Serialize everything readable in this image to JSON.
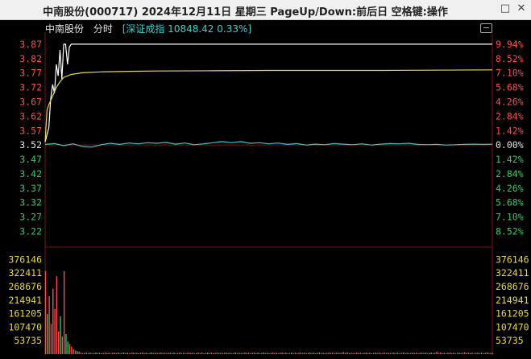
{
  "window": {
    "title": "中南股份(000717) 2024年12月11日 星期三 PageUp/Down:前后日 空格键:操作",
    "minimize_icon": "minimize-icon",
    "close_icon": "close-icon"
  },
  "header": {
    "stock_name": "中南股份",
    "chart_mode": "分时",
    "index_info": "[深证成指 10848.42 0.33%]",
    "toggle_icon": "collapse-icon"
  },
  "colors": {
    "background": "#000000",
    "up": "#ff4d4d",
    "down": "#33cc66",
    "neutral": "#e6e6e6",
    "price_line": "#ffffff",
    "avg_line": "#e8d94a",
    "index_line": "#3fc4c8",
    "volume_label": "#e8d94a",
    "grid": "#7a0f0f"
  },
  "chart_data": [
    {
      "type": "line",
      "title": "",
      "left_axis_ticks": [
        "3.87",
        "3.82",
        "3.77",
        "3.72",
        "3.67",
        "3.62",
        "3.57",
        "3.52",
        "3.47",
        "3.42",
        "3.37",
        "3.32",
        "3.27",
        "3.22"
      ],
      "right_axis_ticks": [
        "9.94%",
        "8.52%",
        "7.10%",
        "5.68%",
        "4.26%",
        "2.84%",
        "1.42%",
        "0.00%",
        "1.42%",
        "2.84%",
        "4.26%",
        "5.68%",
        "7.10%",
        "8.52%"
      ],
      "prev_close": 3.52,
      "ylim": [
        3.185,
        3.895
      ],
      "x_minutes": 240,
      "series": [
        {
          "key": "price",
          "points": [
            [
              0,
              3.53
            ],
            [
              2,
              3.58
            ],
            [
              3,
              3.68
            ],
            [
              4,
              3.73
            ],
            [
              5,
              3.7
            ],
            [
              6,
              3.8
            ],
            [
              7,
              3.76
            ],
            [
              8,
              3.85
            ],
            [
              9,
              3.75
            ],
            [
              10,
              3.87
            ],
            [
              11,
              3.87
            ],
            [
              12,
              3.8
            ],
            [
              13,
              3.86
            ],
            [
              14,
              3.87
            ],
            [
              15,
              3.87
            ],
            [
              240,
              3.87
            ]
          ]
        },
        {
          "key": "avg",
          "points": [
            [
              0,
              3.53
            ],
            [
              1,
              3.64
            ],
            [
              2,
              3.66
            ],
            [
              4,
              3.69
            ],
            [
              6,
              3.72
            ],
            [
              8,
              3.74
            ],
            [
              10,
              3.755
            ],
            [
              14,
              3.765
            ],
            [
              20,
              3.771
            ],
            [
              30,
              3.774
            ],
            [
              45,
              3.776
            ],
            [
              60,
              3.777
            ],
            [
              90,
              3.778
            ],
            [
              120,
              3.779
            ],
            [
              180,
              3.779
            ],
            [
              240,
              3.781
            ]
          ]
        },
        {
          "key": "index",
          "points": [
            [
              0,
              3.522
            ],
            [
              5,
              3.525
            ],
            [
              10,
              3.518
            ],
            [
              15,
              3.524
            ],
            [
              20,
              3.515
            ],
            [
              25,
              3.513
            ],
            [
              30,
              3.521
            ],
            [
              35,
              3.526
            ],
            [
              40,
              3.522
            ],
            [
              45,
              3.527
            ],
            [
              50,
              3.524
            ],
            [
              55,
              3.528
            ],
            [
              60,
              3.526
            ],
            [
              65,
              3.529
            ],
            [
              70,
              3.523
            ],
            [
              75,
              3.527
            ],
            [
              80,
              3.521
            ],
            [
              85,
              3.524
            ],
            [
              90,
              3.528
            ],
            [
              95,
              3.532
            ],
            [
              100,
              3.528
            ],
            [
              105,
              3.532
            ],
            [
              110,
              3.526
            ],
            [
              115,
              3.528
            ],
            [
              120,
              3.524
            ],
            [
              125,
              3.527
            ],
            [
              130,
              3.522
            ],
            [
              135,
              3.525
            ],
            [
              140,
              3.52
            ],
            [
              145,
              3.523
            ],
            [
              150,
              3.521
            ],
            [
              155,
              3.525
            ],
            [
              160,
              3.523
            ],
            [
              165,
              3.521
            ],
            [
              170,
              3.524
            ],
            [
              175,
              3.52
            ],
            [
              180,
              3.523
            ],
            [
              185,
              3.525
            ],
            [
              190,
              3.524
            ],
            [
              195,
              3.526
            ],
            [
              200,
              3.522
            ],
            [
              205,
              3.521
            ],
            [
              210,
              3.522
            ],
            [
              215,
              3.52
            ],
            [
              220,
              3.521
            ],
            [
              225,
              3.522
            ],
            [
              230,
              3.523
            ],
            [
              235,
              3.522
            ],
            [
              240,
              3.523
            ]
          ]
        }
      ]
    },
    {
      "type": "bar",
      "title": "",
      "axis_ticks": [
        "376146",
        "322411",
        "268676",
        "214941",
        "161205",
        "107470",
        "53735"
      ],
      "ylim": [
        0,
        403000
      ],
      "first_minutes": [
        {
          "m": 0,
          "v": 330000,
          "c": "up"
        },
        {
          "m": 1,
          "v": 160000,
          "c": "down"
        },
        {
          "m": 2,
          "v": 230000,
          "c": "up"
        },
        {
          "m": 3,
          "v": 120000,
          "c": "up"
        },
        {
          "m": 4,
          "v": 260000,
          "c": "up"
        },
        {
          "m": 5,
          "v": 180000,
          "c": "up"
        },
        {
          "m": 6,
          "v": 310000,
          "c": "up"
        },
        {
          "m": 7,
          "v": 90000,
          "c": "up"
        },
        {
          "m": 8,
          "v": 150000,
          "c": "down"
        },
        {
          "m": 9,
          "v": 70000,
          "c": "up"
        },
        {
          "m": 10,
          "v": 330000,
          "c": "up"
        },
        {
          "m": 11,
          "v": 80000,
          "c": "down"
        },
        {
          "m": 12,
          "v": 50000,
          "c": "down"
        },
        {
          "m": 13,
          "v": 40000,
          "c": "up"
        },
        {
          "m": 14,
          "v": 30000,
          "c": "up"
        },
        {
          "m": 15,
          "v": 20000,
          "c": "up"
        },
        {
          "m": 16,
          "v": 15000,
          "c": "up"
        },
        {
          "m": 17,
          "v": 12000,
          "c": "down"
        },
        {
          "m": 18,
          "v": 10000,
          "c": "up"
        }
      ],
      "tail_volume": 4000,
      "spikes": [
        {
          "m": 160,
          "v": 9000
        },
        {
          "m": 210,
          "v": 10000
        },
        {
          "m": 225,
          "v": 8000
        }
      ]
    }
  ]
}
